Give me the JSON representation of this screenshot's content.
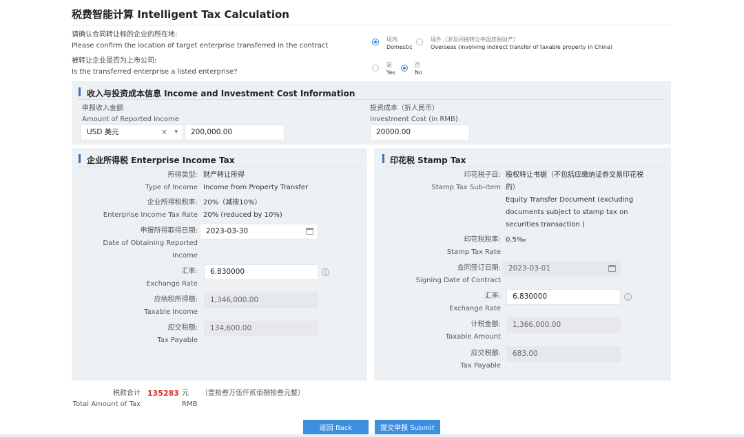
{
  "page": {
    "title": "税费智能计算 Intelligent Tax Calculation"
  },
  "location": {
    "question_cn": "请确认合同转让标的企业的所在地:",
    "question_en": "Please confirm the location of target enterprise transferred in the contract",
    "options": [
      {
        "cn": "境内",
        "en": "Domestic",
        "selected": true
      },
      {
        "cn": "境外（涉及间接转让中国应税财产）",
        "en": "Overseas (involving indirect transfer of taxable property in China)",
        "selected": false
      }
    ]
  },
  "listed": {
    "question_cn": "被转让企业是否为上市公司:",
    "question_en": "Is the transferred enterprise a listed enterprise?",
    "options": [
      {
        "cn": "是",
        "en": "Yes",
        "selected": false
      },
      {
        "cn": "否",
        "en": "No",
        "selected": true
      }
    ]
  },
  "income_section": {
    "title": "收入与投资成本信息 Income and Investment Cost Information",
    "reported_income": {
      "label_cn": "申报收入金额",
      "label_en": "Amount of Reported Income",
      "currency": "USD 美元",
      "clear_glyph": "×",
      "caret_glyph": "▾",
      "value": "200,000.00"
    },
    "investment_cost": {
      "label_cn": "投资成本（折人民币）",
      "label_en": "Investment Cost (in RMB)",
      "value": "20000.00"
    }
  },
  "eit": {
    "title": "企业所得税 Enterprise Income Tax",
    "type_label_cn": "所得类型:",
    "type_label_en": "Type of Income",
    "type_value_cn": "财产转让所得",
    "type_value_en": "Income from Property Transfer",
    "rate_label_cn": "企业所得税税率:",
    "rate_label_en": "Enterprise Income Tax Rate",
    "rate_value_cn": "20%（减按10%）",
    "rate_value_en": "20% (reduced by 10%)",
    "date_label_cn": "申报所得取得日期:",
    "date_label_en_1": "Date of Obtaining Reported",
    "date_label_en_2": "Income",
    "date_value": "2023-03-30",
    "fx_label_cn": "汇率:",
    "fx_label_en": "Exchange Rate",
    "fx_value": "6.830000",
    "taxable_label_cn": "应纳税所得额:",
    "taxable_label_en": "Taxable Income",
    "taxable_value": "1,346,000.00",
    "payable_label_cn": "应交税额:",
    "payable_label_en": "Tax Payable",
    "payable_value": "134,600.00"
  },
  "stamp": {
    "title": "印花税 Stamp Tax",
    "sub_label_cn": "印花税子目:",
    "sub_label_en": "Stamp Tax Sub-item",
    "sub_value_cn_1": "股权转让书据（不包括应缴纳证券交易印花税",
    "sub_value_cn_2": "的）",
    "sub_value_en_1": "Equity Transfer Document (excluding",
    "sub_value_en_2": "documents subject to stamp tax on",
    "sub_value_en_3": "securities transaction )",
    "rate_label_cn": "印花税税率:",
    "rate_label_en": "Stamp Tax Rate",
    "rate_value": "0.5‰",
    "date_label_cn": "合同签订日期:",
    "date_label_en": "Signing Date of Contract",
    "date_value": "2023-03-01",
    "fx_label_cn": "汇率:",
    "fx_label_en": "Exchange Rate",
    "fx_value": "6.830000",
    "amount_label_cn": "计税金额:",
    "amount_label_en": "Taxable Amount",
    "amount_value": "1,366,000.00",
    "payable_label_cn": "应交税额:",
    "payable_label_en": "Tax Payable",
    "payable_value": "683.00"
  },
  "total": {
    "label_cn": "税款合计",
    "label_en": "Total Amount of Tax",
    "amount": "135283",
    "unit_cn": "元",
    "unit_en": "RMB",
    "in_words": "（壹拾叁万伍仟贰佰捌拾叁元整）"
  },
  "buttons": {
    "back": "返回 Back",
    "submit": "提交申报 Submit"
  },
  "info_glyph": "i",
  "colors": {
    "accent": "#3e8ee0",
    "total_red": "#d9352e",
    "panel_bg": "#eef1f4"
  }
}
